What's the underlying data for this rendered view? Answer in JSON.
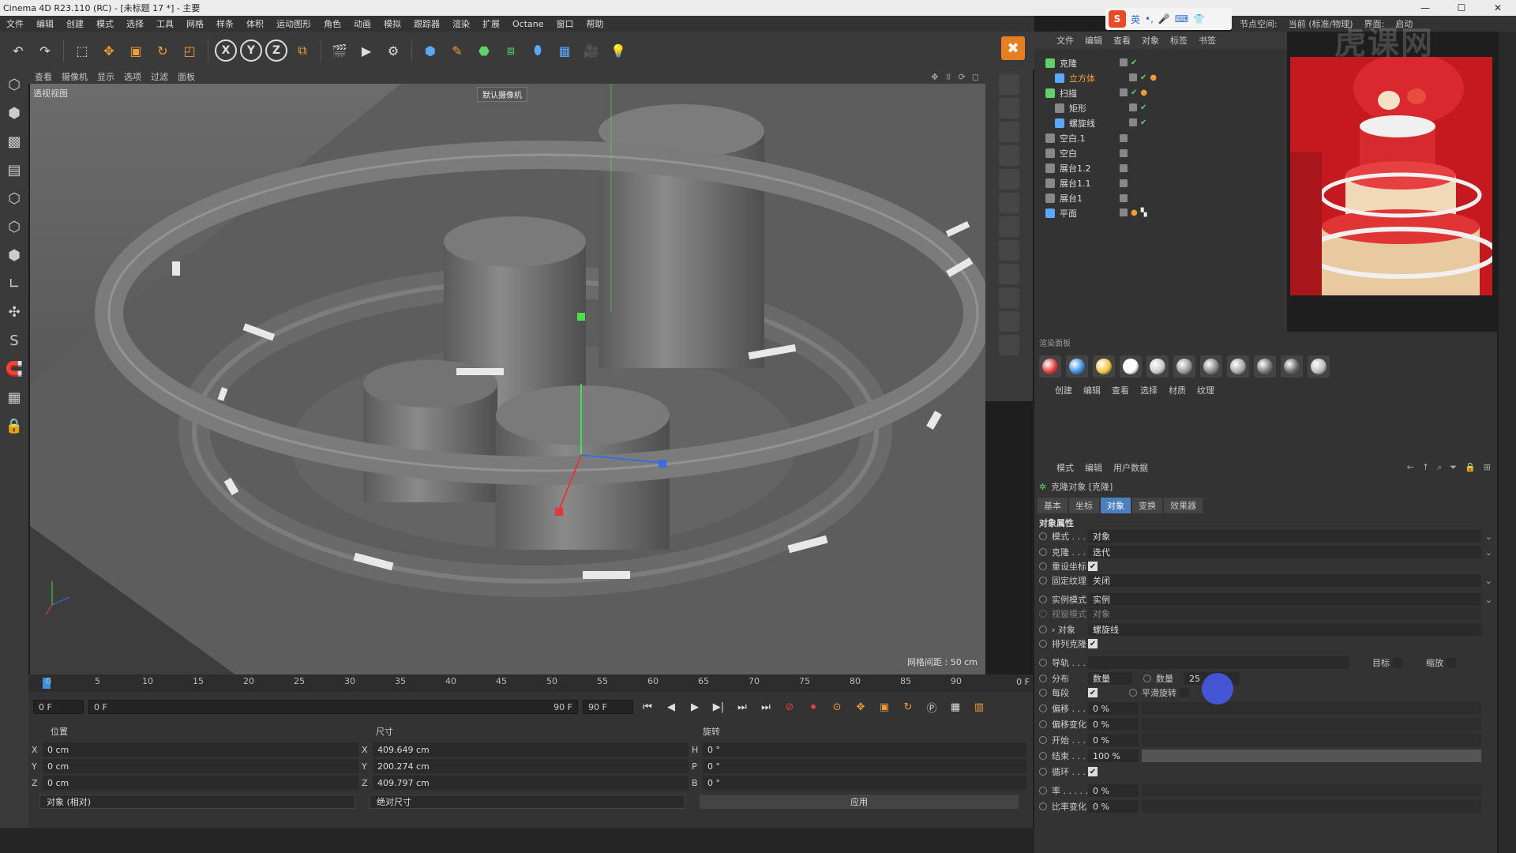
{
  "window": {
    "title": "Cinema 4D R23.110 (RC) - [未标题 17 *] - 主要"
  },
  "menus": [
    "文件",
    "编辑",
    "创建",
    "模式",
    "选择",
    "工具",
    "网格",
    "样条",
    "体积",
    "运动图形",
    "角色",
    "动画",
    "模拟",
    "跟踪器",
    "渲染",
    "扩展",
    "Octane",
    "窗口",
    "帮助"
  ],
  "ime": {
    "label": "英"
  },
  "right_menu": [
    "界面:",
    "启动 (用户)",
    "节点空间:",
    "当前 (标准/物理)",
    "界面:",
    "启动"
  ],
  "watermark": "虎课网",
  "viewport": {
    "menu": [
      "查看",
      "摄像机",
      "显示",
      "选项",
      "过滤",
      "面板"
    ],
    "label": "透视视图",
    "camera": "默认摄像机",
    "grid": "网格间距 : 50 cm"
  },
  "timeline": {
    "ticks": [
      "0",
      "5",
      "10",
      "15",
      "20",
      "25",
      "30",
      "35",
      "40",
      "45",
      "50",
      "55",
      "60",
      "65",
      "70",
      "75",
      "80",
      "85",
      "90"
    ],
    "end_frame_label": "0 F",
    "current": "0 F",
    "start_field": "0 F",
    "end_field": "90 F",
    "end_field2": "90 F"
  },
  "coords": {
    "headers": {
      "position": "位置",
      "size": "尺寸",
      "rotation": "旋转"
    },
    "rows": [
      {
        "axis": "X",
        "pos": "0 cm",
        "saxis": "X",
        "size": "409.649 cm",
        "raxis": "H",
        "rot": "0 °"
      },
      {
        "axis": "Y",
        "pos": "0 cm",
        "saxis": "Y",
        "size": "200.274 cm",
        "raxis": "P",
        "rot": "0 °"
      },
      {
        "axis": "Z",
        "pos": "0 cm",
        "saxis": "Z",
        "size": "409.797 cm",
        "raxis": "B",
        "rot": "0 °"
      }
    ],
    "mode": "对象 (相对)",
    "size_mode": "绝对尺寸",
    "apply": "应用"
  },
  "object_manager": {
    "menu": [
      "文件",
      "编辑",
      "查看",
      "对象",
      "标签",
      "书签"
    ],
    "items": [
      {
        "name": "克隆",
        "color": "#5fd36a",
        "selected": false
      },
      {
        "name": "立方体",
        "color": "#5aa9ff",
        "selected": true
      },
      {
        "name": "扫描",
        "color": "#5fd36a",
        "selected": false
      },
      {
        "name": "矩形",
        "color": "#aaa",
        "selected": false
      },
      {
        "name": "螺旋线",
        "color": "#5aa9ff",
        "selected": false
      },
      {
        "name": "空白.1",
        "color": "#aaa",
        "selected": false
      },
      {
        "name": "空白",
        "color": "#aaa",
        "selected": false
      },
      {
        "name": "展台1.2",
        "color": "#aaa",
        "selected": false
      },
      {
        "name": "展台1.1",
        "color": "#aaa",
        "selected": false
      },
      {
        "name": "展台1",
        "color": "#aaa",
        "selected": false
      },
      {
        "name": "平面",
        "color": "#5aa9ff",
        "selected": false
      }
    ]
  },
  "material_panel": {
    "title": "渲染面板",
    "menu": [
      "创建",
      "编辑",
      "查看",
      "选择",
      "材质",
      "纹理"
    ],
    "ball_colors": [
      "#e23b3b",
      "#3a8fe0",
      "#f5c542",
      "#ffffff",
      "#cccccc",
      "#999999",
      "#888888",
      "#aaaaaa",
      "#777777",
      "#666666",
      "#bbbbbb"
    ]
  },
  "attributes": {
    "menu": [
      "模式",
      "编辑",
      "用户数据"
    ],
    "title": "克隆对象 [克隆]",
    "tabs": [
      "基本",
      "坐标",
      "对象",
      "变换",
      "效果器"
    ],
    "active_tab": "对象",
    "section": "对象属性",
    "rows": [
      {
        "label": "模式 . . . .",
        "value": "对象"
      },
      {
        "label": "克隆 . . . .",
        "value": "迭代"
      },
      {
        "label": "重设坐标",
        "value": ""
      },
      {
        "label": "固定纹理",
        "value": "关闭"
      },
      {
        "label": "实例模式",
        "value": "实例"
      },
      {
        "label": "视窗模式",
        "value": "对象"
      },
      {
        "label": "› 对象",
        "value": "螺旋线"
      },
      {
        "label": "排列克隆",
        "value": ""
      },
      {
        "label": "导轨 . . . .",
        "value": ""
      },
      {
        "label": "分布",
        "value": "数量"
      },
      {
        "label": "每段",
        "value": ""
      },
      {
        "label": "偏移 . . . .",
        "value": "0 %"
      },
      {
        "label": "偏移变化",
        "value": "0 %"
      },
      {
        "label": "开始 . . . .",
        "value": "0 %"
      },
      {
        "label": "结束 . . . .",
        "value": "100 %"
      },
      {
        "label": "循环 . . . .",
        "value": ""
      },
      {
        "label": "率 . . . . .",
        "value": "0 %"
      },
      {
        "label": "比率变化",
        "value": "0 %"
      }
    ],
    "count_label": "数量",
    "count_value": "25",
    "target_label": "目标",
    "scale_label": "缩放",
    "smooth_label": "平滑旋转"
  }
}
